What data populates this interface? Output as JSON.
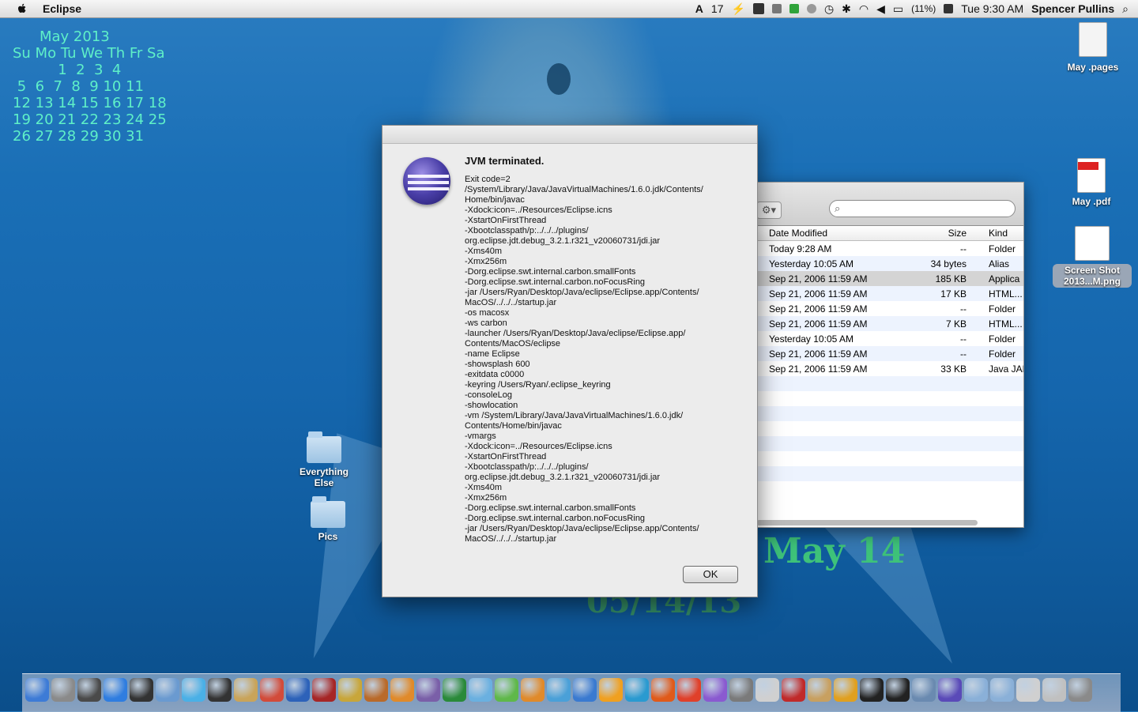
{
  "menubar": {
    "app_name": "Eclipse",
    "status_items": [
      "17",
      "(11%)"
    ],
    "clock": "Tue 9:30 AM",
    "user": "Spencer Pullins"
  },
  "calendar": {
    "title": "May 2013",
    "header": "Su Mo Tu We Th Fr Sa",
    "rows": [
      "          1  2  3  4",
      " 5  6  7  8  9 10 11",
      "12 13 14 15 16 17 18",
      "19 20 21 22 23 24 25",
      "26 27 28 29 30 31"
    ]
  },
  "desktop_icons": [
    {
      "label": "May .pages"
    },
    {
      "label": "May .pdf"
    },
    {
      "label": "Screen Shot 2013...M.png"
    },
    {
      "label": "Everything Else"
    },
    {
      "label": "Pics"
    }
  ],
  "date_widget": {
    "line1": "May  14",
    "line2": "05/14/13"
  },
  "finder": {
    "columns": {
      "date": "Date Modified",
      "size": "Size",
      "kind": "Kind"
    },
    "rows": [
      {
        "date": "Today 9:28 AM",
        "size": "--",
        "kind": "Folder"
      },
      {
        "date": "Yesterday 10:05 AM",
        "size": "34 bytes",
        "kind": "Alias"
      },
      {
        "date": "Sep 21, 2006 11:59 AM",
        "size": "185 KB",
        "kind": "Applica"
      },
      {
        "date": "Sep 21, 2006 11:59 AM",
        "size": "17 KB",
        "kind": "HTML..."
      },
      {
        "date": "Sep 21, 2006 11:59 AM",
        "size": "--",
        "kind": "Folder"
      },
      {
        "date": "Sep 21, 2006 11:59 AM",
        "size": "7 KB",
        "kind": "HTML..."
      },
      {
        "date": "Yesterday 10:05 AM",
        "size": "--",
        "kind": "Folder"
      },
      {
        "date": "Sep 21, 2006 11:59 AM",
        "size": "--",
        "kind": "Folder"
      },
      {
        "date": "Sep 21, 2006 11:59 AM",
        "size": "33 KB",
        "kind": "Java JAR"
      }
    ]
  },
  "dialog": {
    "title": "JVM terminated.",
    "body": "Exit code=2\n/System/Library/Java/JavaVirtualMachines/1.6.0.jdk/Contents/\nHome/bin/javac\n-Xdock:icon=../Resources/Eclipse.icns\n-XstartOnFirstThread\n-Xbootclasspath/p:../../../plugins/\norg.eclipse.jdt.debug_3.2.1.r321_v20060731/jdi.jar\n-Xms40m\n-Xmx256m\n-Dorg.eclipse.swt.internal.carbon.smallFonts\n-Dorg.eclipse.swt.internal.carbon.noFocusRing\n-jar /Users/Ryan/Desktop/Java/eclipse/Eclipse.app/Contents/\nMacOS/../../../startup.jar\n-os macosx\n-ws carbon\n-launcher /Users/Ryan/Desktop/Java/eclipse/Eclipse.app/\nContents/MacOS/eclipse\n-name Eclipse\n-showsplash 600\n-exitdata c0000\n-keyring /Users/Ryan/.eclipse_keyring\n-consoleLog\n-showlocation\n-vm /System/Library/Java/JavaVirtualMachines/1.6.0.jdk/\nContents/Home/bin/javac\n-vmargs\n-Xdock:icon=../Resources/Eclipse.icns\n-XstartOnFirstThread\n-Xbootclasspath/p:../../../plugins/\norg.eclipse.jdt.debug_3.2.1.r321_v20060731/jdi.jar\n-Xms40m\n-Xmx256m\n-Dorg.eclipse.swt.internal.carbon.smallFonts\n-Dorg.eclipse.swt.internal.carbon.noFocusRing\n-jar /Users/Ryan/Desktop/Java/eclipse/Eclipse.app/Contents/\nMacOS/../../../startup.jar",
    "ok_label": "OK"
  },
  "dock": {
    "icon_colors": [
      "#3d7bd6",
      "#8a8a8a",
      "#4a4a4a",
      "#2f7de0",
      "#333333",
      "#6a9ad0",
      "#4ab0e6",
      "#333333",
      "#c9a45a",
      "#d24b3a",
      "#2d62b9",
      "#a62626",
      "#c8a63a",
      "#b96a2a",
      "#e08a2a",
      "#7a5fa8",
      "#2a8a3a",
      "#6ab0e0",
      "#5fb84a",
      "#e08a2a",
      "#4aa0d8",
      "#3a7ad0",
      "#f0a020",
      "#2a9ad0",
      "#e05a1a",
      "#e0402a",
      "#8a5ad0",
      "#7a7a7a",
      "#d0d0d0",
      "#c02a2a",
      "#c8a060",
      "#e0a020",
      "#222222",
      "#222222",
      "#6a8ab0",
      "#5a4ab8",
      "#8ab0d8",
      "#8ab0d8",
      "#d0d0d0",
      "#c0c0c0",
      "#8a8a8a"
    ]
  }
}
